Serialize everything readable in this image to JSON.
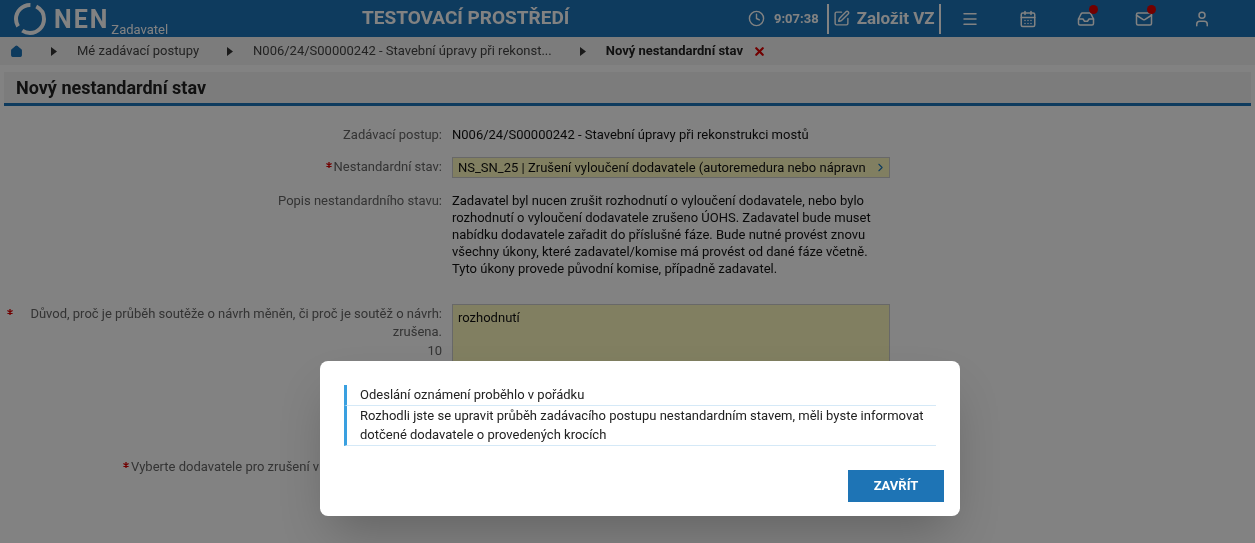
{
  "header": {
    "logo": "NEN",
    "subtitle": "Zadavatel",
    "title": "TESTOVACÍ PROSTŘEDÍ",
    "time": "9:07:38",
    "create_button": "Založit VZ",
    "tools": [
      {
        "kind": "menu",
        "notification": false
      },
      {
        "kind": "calendar",
        "notification": false
      },
      {
        "kind": "inbox",
        "notification": true
      },
      {
        "kind": "mail",
        "notification": true
      },
      {
        "kind": "user",
        "notification": false
      }
    ]
  },
  "breadcrumbs": [
    {
      "label": "Mé zadávací postupy",
      "current": false
    },
    {
      "label": "N006/24/S00000242 - Stavební úpravy při rekonst...",
      "current": false
    },
    {
      "label": "Nový nestandardní stav",
      "current": true
    }
  ],
  "page_title": "Nový nestandardní stav",
  "form": [
    {
      "kind": "text",
      "label": "Zadávací postup:",
      "required": false,
      "value": "N006/24/S00000242 - Stavební úpravy při rekonstrukci mostů"
    },
    {
      "kind": "select",
      "label": "Nestandardní stav:",
      "required": true,
      "value": "NS_SN_25 | Zrušení vyloučení dodavatele (autoremedura nebo nápravn"
    },
    {
      "kind": "text",
      "label": "Popis nestandardního stavu:",
      "required": false,
      "value": "Zadavatel byl nucen zrušit rozhodnutí o vyloučení dodavatele, nebo bylo rozhodnutí o vyloučení dodavatele zrušeno ÚOHS. Zadavatel bude muset nabídku dodavatele zařadit do příslušné fáze. Bude nutné provést znovu všechny úkony, které zadavatel/komise má provést od dané fáze včetně. Tyto úkony provede původní komise, případně zadavatel."
    },
    {
      "kind": "textarea",
      "label": "Důvod, proč je průběh soutěže o návrh měněn, či proč je soutěž o návrh: zrušena.",
      "count": "10",
      "required": true,
      "value": "rozhodnutí"
    },
    {
      "kind": "label",
      "label": "Vyberte dodavatele pro zrušení v",
      "required": true
    }
  ],
  "dialog": {
    "messages": [
      "Odeslání oznámení proběhlo v pořádku",
      "Rozhodli jste se upravit průběh zadávacího postupu nestandardním stavem, měli byste informovat dotčené dodavatele o provedených krocích"
    ],
    "button": "ZAVŘÍT"
  }
}
